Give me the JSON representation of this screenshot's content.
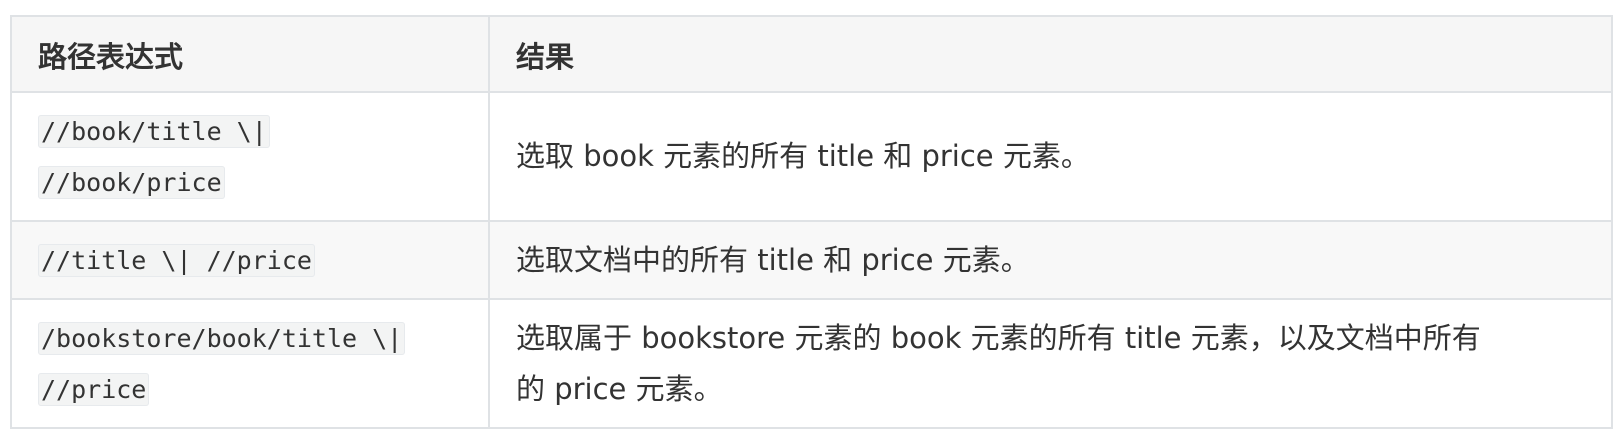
{
  "table": {
    "headers": {
      "expression": "路径表达式",
      "result": "结果"
    },
    "rows": [
      {
        "expression_line1": "//book/title \\|",
        "expression_line2": "//book/price",
        "result": "选取 book 元素的所有 title 和 price 元素。"
      },
      {
        "expression_line1": "//title \\| //price",
        "result": "选取文档中的所有 title 和 price 元素。"
      },
      {
        "expression_line1": "/bookstore/book/title \\|",
        "expression_line2": "//price",
        "result_line1": "选取属于 bookstore 元素的 book 元素的所有 title 元素，以及文档中所有",
        "result_line2": "的 price 元素。"
      }
    ]
  }
}
